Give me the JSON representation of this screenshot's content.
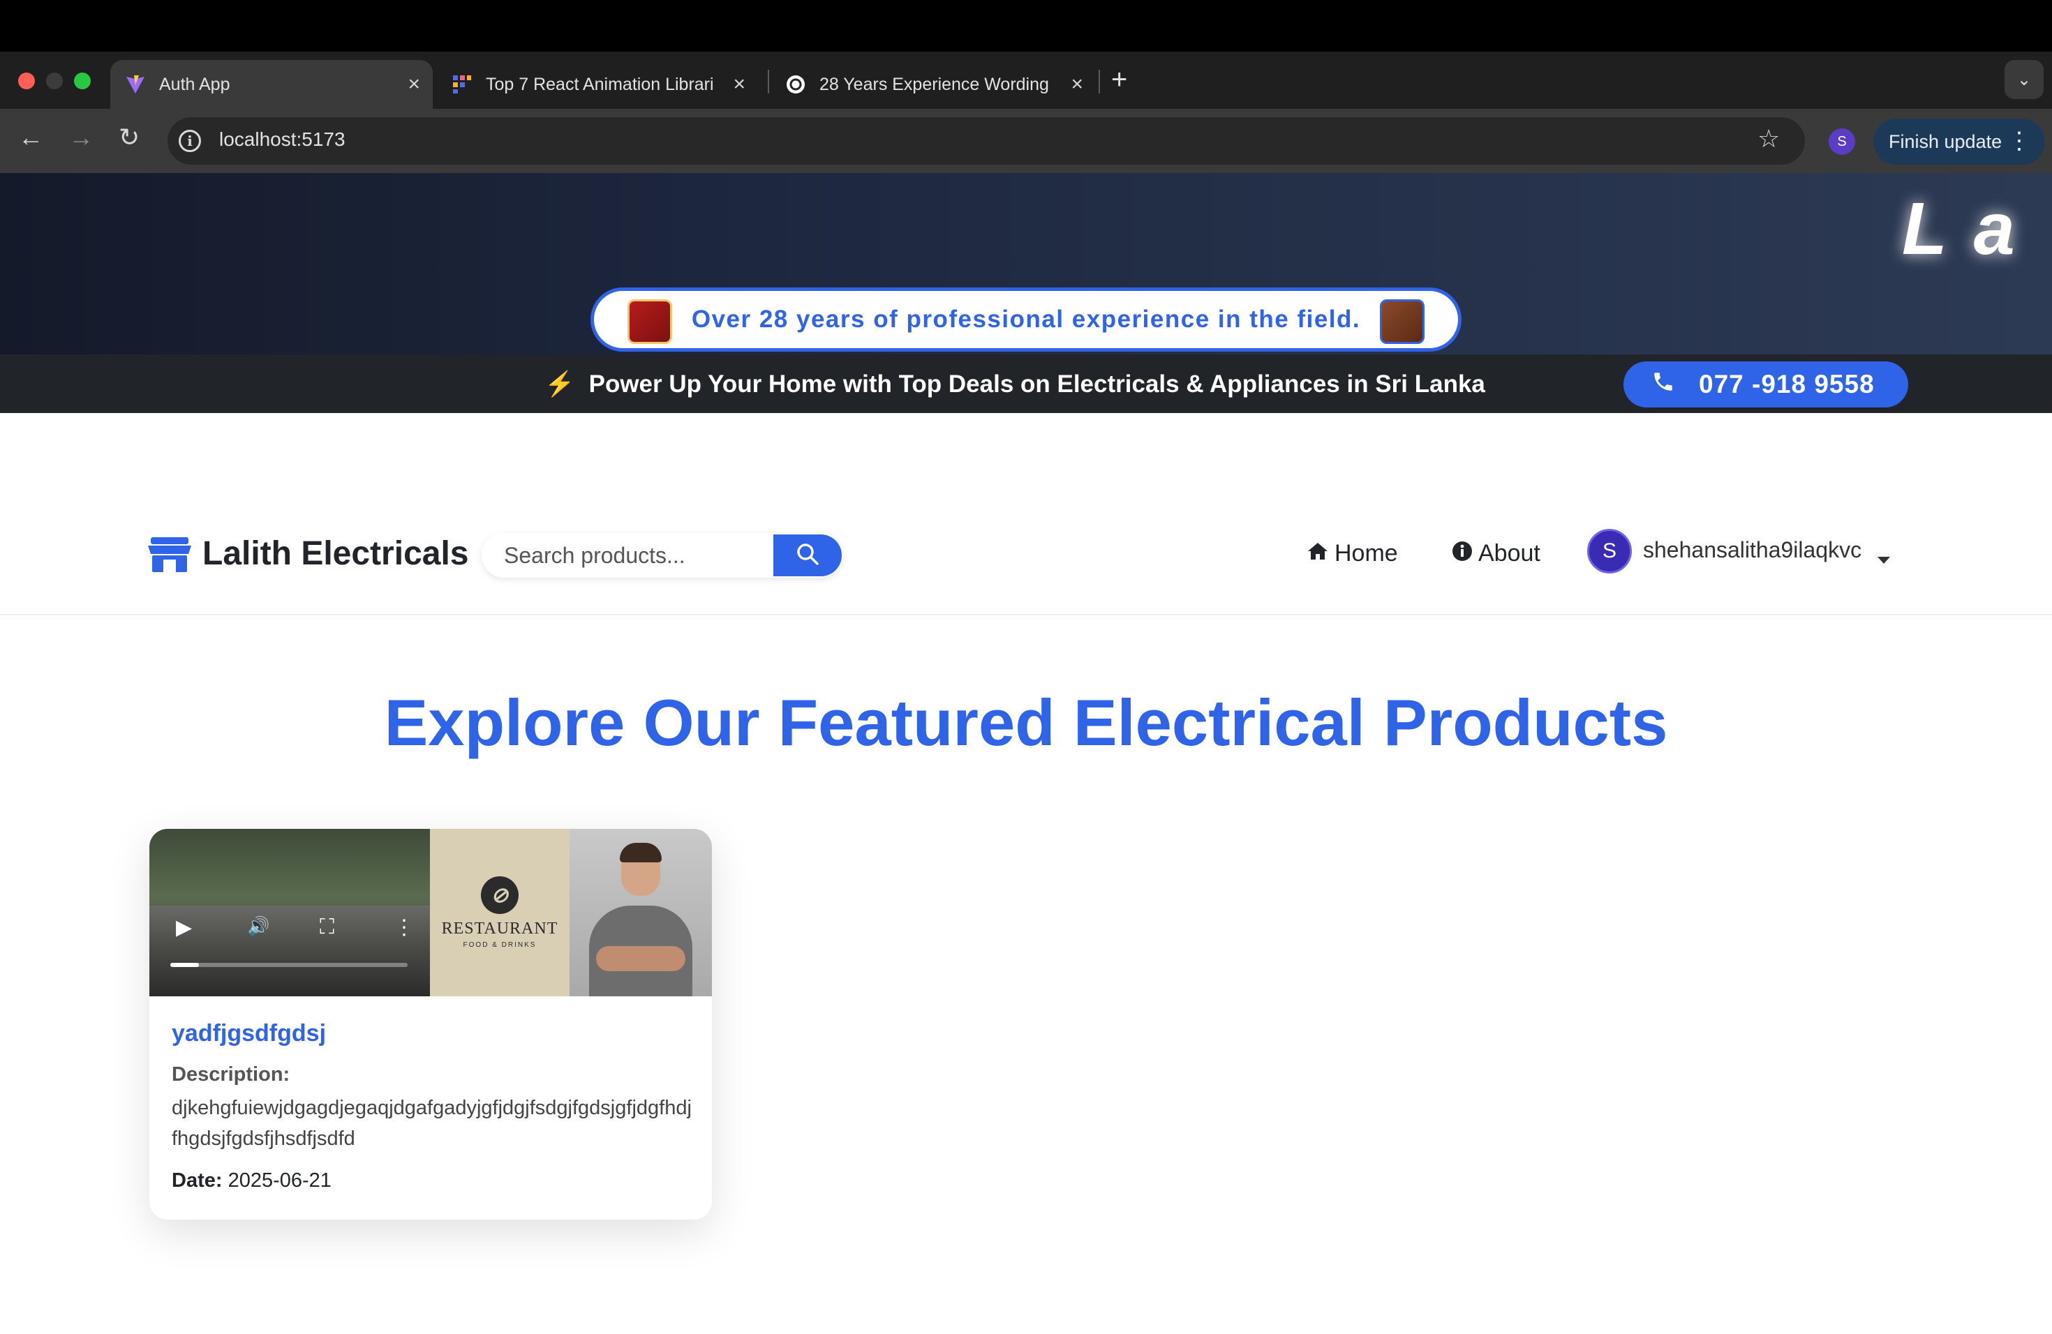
{
  "browser": {
    "tabs": [
      {
        "title": "Auth App",
        "icon": "vite-icon",
        "active": true
      },
      {
        "title": "Top 7 React Animation Librari",
        "icon": "grid-icon",
        "active": false
      },
      {
        "title": "28 Years Experience Wording",
        "icon": "openai-icon",
        "active": false
      }
    ],
    "url": "localhost:5173",
    "profile_initial": "S",
    "finish_update_label": "Finish update"
  },
  "hero": {
    "brand_text": "La l",
    "promo_text": "Over 28 years of professional experience in the field."
  },
  "deals_bar": {
    "text": "Power Up Your Home with Top Deals on Electricals & Appliances in Sri Lanka",
    "phone": "077 -918 9558"
  },
  "navbar": {
    "logo_text": "Lalith Electricals",
    "search_placeholder": "Search products...",
    "links": [
      {
        "label": "Home",
        "icon": "home-icon"
      },
      {
        "label": "About",
        "icon": "info-icon"
      }
    ],
    "user": {
      "initial": "S",
      "name": "shehansalitha9ilaqkvc"
    }
  },
  "main": {
    "heading": "Explore Our Featured Electrical Products",
    "products": [
      {
        "title": "yadfjgsdfgdsj",
        "description_label": "Description:",
        "description": "djkehgfuiewjdgagdjegaqjdgafgadyjgfjdgjfsdgjfgdsjgfjdgfhdjfhgdsjfgdsfjhsdfjsdfd",
        "date_label": "Date:",
        "date": "2025-06-21",
        "restaurant_label": "RESTAURANT",
        "restaurant_sub": "FOOD & DRINKS",
        "video_progress": 0.12
      }
    ]
  },
  "colors": {
    "accent": "#2f63e8",
    "deals_bar_bg": "#212529",
    "hero_bg": "#1f2a42"
  }
}
